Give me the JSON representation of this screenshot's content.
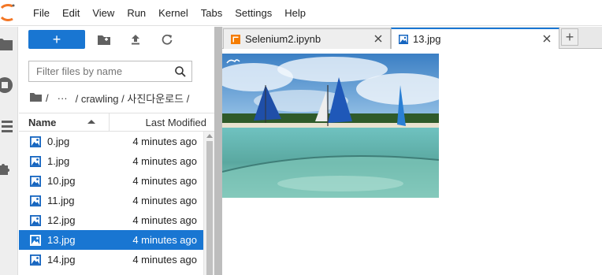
{
  "menu": {
    "items": [
      "File",
      "Edit",
      "View",
      "Run",
      "Kernel",
      "Tabs",
      "Settings",
      "Help"
    ]
  },
  "sidebar": {
    "icons": [
      "folder-icon",
      "running-icon",
      "toc-icon",
      "extension-icon"
    ]
  },
  "filebrowser": {
    "new_label": "+",
    "filter_placeholder": "Filter files by name",
    "breadcrumb": [
      "/",
      "···",
      "/ crawling / 사진다운로드 /"
    ],
    "columns": {
      "name": "Name",
      "modified": "Last Modified"
    },
    "files": [
      {
        "name": "0.jpg",
        "modified": "4 minutes ago",
        "selected": false
      },
      {
        "name": "1.jpg",
        "modified": "4 minutes ago",
        "selected": false
      },
      {
        "name": "10.jpg",
        "modified": "4 minutes ago",
        "selected": false
      },
      {
        "name": "11.jpg",
        "modified": "4 minutes ago",
        "selected": false
      },
      {
        "name": "12.jpg",
        "modified": "4 minutes ago",
        "selected": false
      },
      {
        "name": "13.jpg",
        "modified": "4 minutes ago",
        "selected": true
      },
      {
        "name": "14.jpg",
        "modified": "4 minutes ago",
        "selected": false
      }
    ]
  },
  "tabs": [
    {
      "label": "Selenium2.ipynb",
      "type": "notebook",
      "active": false
    },
    {
      "label": "13.jpg",
      "type": "image",
      "active": true
    }
  ],
  "colors": {
    "accent": "#1976d2",
    "notebook_icon": "#f57c00"
  }
}
